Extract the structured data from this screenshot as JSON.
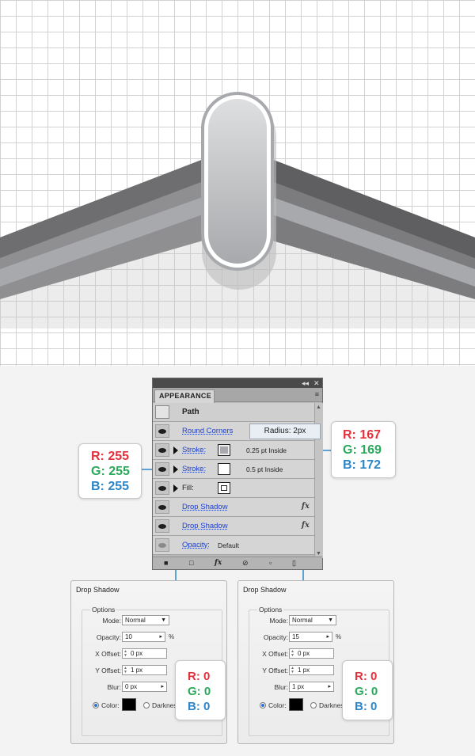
{
  "panel": {
    "title": "APPEARANCE",
    "titlebar_controls": [
      "◂◂",
      "✕"
    ],
    "menu_icon": "≡",
    "rows": {
      "path": "Path",
      "round_corners": "Round Corners",
      "radius_popup": "Radius: 2px",
      "stroke1": "Stroke:",
      "stroke1_value": "0.25 pt  Inside",
      "stroke2": "Stroke:",
      "stroke2_value": "0.5 pt  Inside",
      "fill": "Fill:",
      "drop_shadow_1": "Drop Shadow",
      "drop_shadow_2": "Drop Shadow",
      "opacity": "Opacity:",
      "opacity_value": "Default",
      "fx": "fx"
    },
    "footer": {
      "fx": "fx",
      "icons": [
        "new-art-icon",
        "fx-icon",
        "clear-icon",
        "duplicate-icon",
        "delete-icon"
      ]
    }
  },
  "callouts": {
    "left": {
      "r": "R: 255",
      "g": "G: 255",
      "b": "B: 255"
    },
    "right": {
      "r": "R: 167",
      "g": "G: 169",
      "b": "B: 172"
    },
    "ds1": {
      "r": "R: 0",
      "g": "G: 0",
      "b": "B: 0"
    },
    "ds2": {
      "r": "R: 0",
      "g": "G: 0",
      "b": "B: 0"
    }
  },
  "drop_shadow_1": {
    "title": "Drop Shadow",
    "options": "Options",
    "mode_label": "Mode:",
    "mode_value": "Normal",
    "opacity_label": "Opacity:",
    "opacity_value": "10",
    "pct": "%",
    "xoffset_label": "X Offset:",
    "xoffset_value": "0 px",
    "yoffset_label": "Y Offset:",
    "yoffset_value": "1 px",
    "blur_label": "Blur:",
    "blur_value": "0 px",
    "color_label": "Color:",
    "darkness_label": "Darkness"
  },
  "drop_shadow_2": {
    "title": "Drop Shadow",
    "options": "Options",
    "mode_label": "Mode:",
    "mode_value": "Normal",
    "opacity_label": "Opacity:",
    "opacity_value": "15",
    "pct": "%",
    "xoffset_label": "X Offset:",
    "xoffset_value": "0 px",
    "yoffset_label": "Y Offset:",
    "yoffset_value": "1 px",
    "blur_label": "Blur:",
    "blur_value": "1 px",
    "color_label": "Color:",
    "darkness_label": "Darkness"
  },
  "colors": {
    "red": "#e3313c",
    "green": "#2aa85b",
    "blue": "#2d86c7",
    "link": "#1d3fd2",
    "connector": "#2d86c7"
  }
}
